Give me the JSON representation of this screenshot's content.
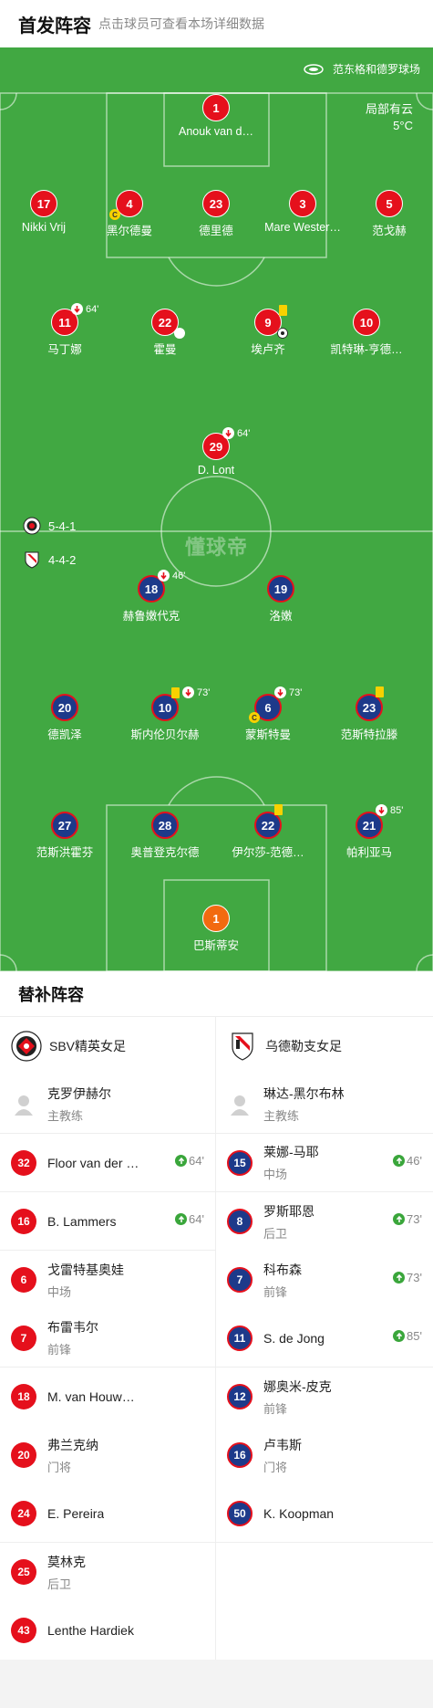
{
  "header": {
    "title": "首发阵容",
    "subtitle": "点击球员可查看本场详细数据"
  },
  "match": {
    "venue": "范东格和德罗球场",
    "weather": "局部有云",
    "temperature": "5°C",
    "watermark": "懂球帝"
  },
  "formations": {
    "home": "5-4-1",
    "away": "4-4-2"
  },
  "pitch_players": [
    {
      "num": "1",
      "name": "Anouk van d…",
      "team": "home",
      "role": "gk"
    },
    {
      "num": "17",
      "name": "Nikki Vrij",
      "team": "home"
    },
    {
      "num": "4",
      "name": "黑尔德曼",
      "team": "home",
      "captain": "C"
    },
    {
      "num": "23",
      "name": "德里德",
      "team": "home"
    },
    {
      "num": "3",
      "name": "Mare Wester…",
      "team": "home"
    },
    {
      "num": "5",
      "name": "范戈赫",
      "team": "home"
    },
    {
      "num": "11",
      "name": "马丁娜",
      "team": "home",
      "sub_minute": "64'"
    },
    {
      "num": "22",
      "name": "霍曼",
      "team": "home",
      "assist": true
    },
    {
      "num": "9",
      "name": "埃卢齐",
      "team": "home",
      "yellow": true,
      "goal": true
    },
    {
      "num": "10",
      "name": "凯特琳-亨德…",
      "team": "home"
    },
    {
      "num": "29",
      "name": "D. Lont",
      "team": "home",
      "sub_minute": "64'"
    },
    {
      "num": "18",
      "name": "赫鲁嫩代克",
      "team": "away",
      "sub_minute": "46'"
    },
    {
      "num": "19",
      "name": "洛嫩",
      "team": "away"
    },
    {
      "num": "20",
      "name": "德凯泽",
      "team": "away"
    },
    {
      "num": "10",
      "name": "斯内伦贝尔赫",
      "team": "away",
      "yellow": true,
      "sub_minute": "73'"
    },
    {
      "num": "6",
      "name": "蒙斯特曼",
      "team": "away",
      "captain": "C",
      "sub_minute": "73'"
    },
    {
      "num": "23",
      "name": "范斯特拉滕",
      "team": "away",
      "yellow": true
    },
    {
      "num": "27",
      "name": "范斯洪霍芬",
      "team": "away"
    },
    {
      "num": "28",
      "name": "奥普登克尔德",
      "team": "away"
    },
    {
      "num": "22",
      "name": "伊尔莎-范德…",
      "team": "away",
      "yellow": true
    },
    {
      "num": "21",
      "name": "帕利亚马",
      "team": "away",
      "sub_minute": "85'"
    },
    {
      "num": "1",
      "name": "巴斯蒂安",
      "team": "away",
      "role": "gk"
    }
  ],
  "subs": {
    "title": "替补阵容",
    "home": {
      "team_name": "SBV精英女足",
      "coach": {
        "name": "克罗伊赫尔",
        "role": "主教练"
      },
      "players": [
        {
          "num": "32",
          "name": "Floor van der …",
          "pos": "",
          "in": "64'"
        },
        {
          "num": "16",
          "name": "B. Lammers",
          "pos": "",
          "in": "64'"
        },
        {
          "num": "6",
          "name": "戈雷特基奥娃",
          "pos": "中场",
          "in": ""
        },
        {
          "num": "7",
          "name": "布雷韦尔",
          "pos": "前锋",
          "in": ""
        },
        {
          "num": "18",
          "name": "M. van Houw…",
          "pos": "",
          "in": ""
        },
        {
          "num": "20",
          "name": "弗兰克纳",
          "pos": "门将",
          "in": ""
        },
        {
          "num": "24",
          "name": "E. Pereira",
          "pos": "",
          "in": ""
        },
        {
          "num": "25",
          "name": "莫林克",
          "pos": "后卫",
          "in": ""
        },
        {
          "num": "43",
          "name": "Lenthe Hardiek",
          "pos": "",
          "in": ""
        }
      ]
    },
    "away": {
      "team_name": "乌德勒支女足",
      "coach": {
        "name": "琳达-黑尔布林",
        "role": "主教练"
      },
      "players": [
        {
          "num": "15",
          "name": "莱娜-马耶",
          "pos": "中场",
          "in": "46'"
        },
        {
          "num": "8",
          "name": "罗斯耶恩",
          "pos": "后卫",
          "in": "73'"
        },
        {
          "num": "7",
          "name": "科布森",
          "pos": "前锋",
          "in": "73'"
        },
        {
          "num": "11",
          "name": "S. de Jong",
          "pos": "",
          "in": "85'"
        },
        {
          "num": "12",
          "name": "娜奥米-皮克",
          "pos": "前锋",
          "in": ""
        },
        {
          "num": "16",
          "name": "卢韦斯",
          "pos": "门将",
          "in": ""
        },
        {
          "num": "50",
          "name": "K. Koopman",
          "pos": "",
          "in": ""
        }
      ]
    }
  },
  "colors": {
    "pitch": "#41a842",
    "home": "#e5101c",
    "away": "#1d3a8a",
    "goalkeeper": "#f26a10",
    "yellow_card": "#f8d100"
  }
}
